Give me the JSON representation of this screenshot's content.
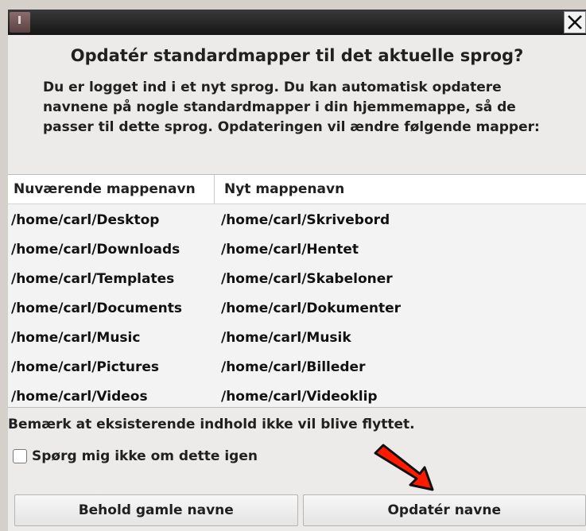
{
  "window": {
    "close_icon": "close-icon",
    "app_icon": "app-icon"
  },
  "dialog": {
    "heading": "Opdatér standardmapper til det aktuelle sprog?",
    "description": [
      "Du er logget ind i et nyt sprog. Du kan automatisk opdatere",
      "navnene på nogle standardmapper i din hjemmemappe, så de",
      "passer til dette sprog. Opdateringen vil ændre følgende mapper:"
    ],
    "table": {
      "headers": [
        "Nuværende mappenavn",
        "Nyt mappenavn"
      ],
      "rows": [
        [
          "/home/carl/Desktop",
          "/home/carl/Skrivebord"
        ],
        [
          "/home/carl/Downloads",
          "/home/carl/Hentet"
        ],
        [
          "/home/carl/Templates",
          "/home/carl/Skabeloner"
        ],
        [
          "/home/carl/Documents",
          "/home/carl/Dokumenter"
        ],
        [
          "/home/carl/Music",
          "/home/carl/Musik"
        ],
        [
          "/home/carl/Pictures",
          "/home/carl/Billeder"
        ],
        [
          "/home/carl/Videos",
          "/home/carl/Videoklip"
        ]
      ]
    },
    "note": "Bemærk at eksisterende indhold ikke vil blive flyttet.",
    "checkbox": {
      "label": "Spørg mig ikke om dette igen",
      "checked": false
    },
    "buttons": {
      "keep": "Behold gamle navne",
      "update": "Opdatér navne"
    }
  },
  "colors": {
    "arrow": "#ff1a00",
    "titlebar": "#1e1e1e"
  }
}
